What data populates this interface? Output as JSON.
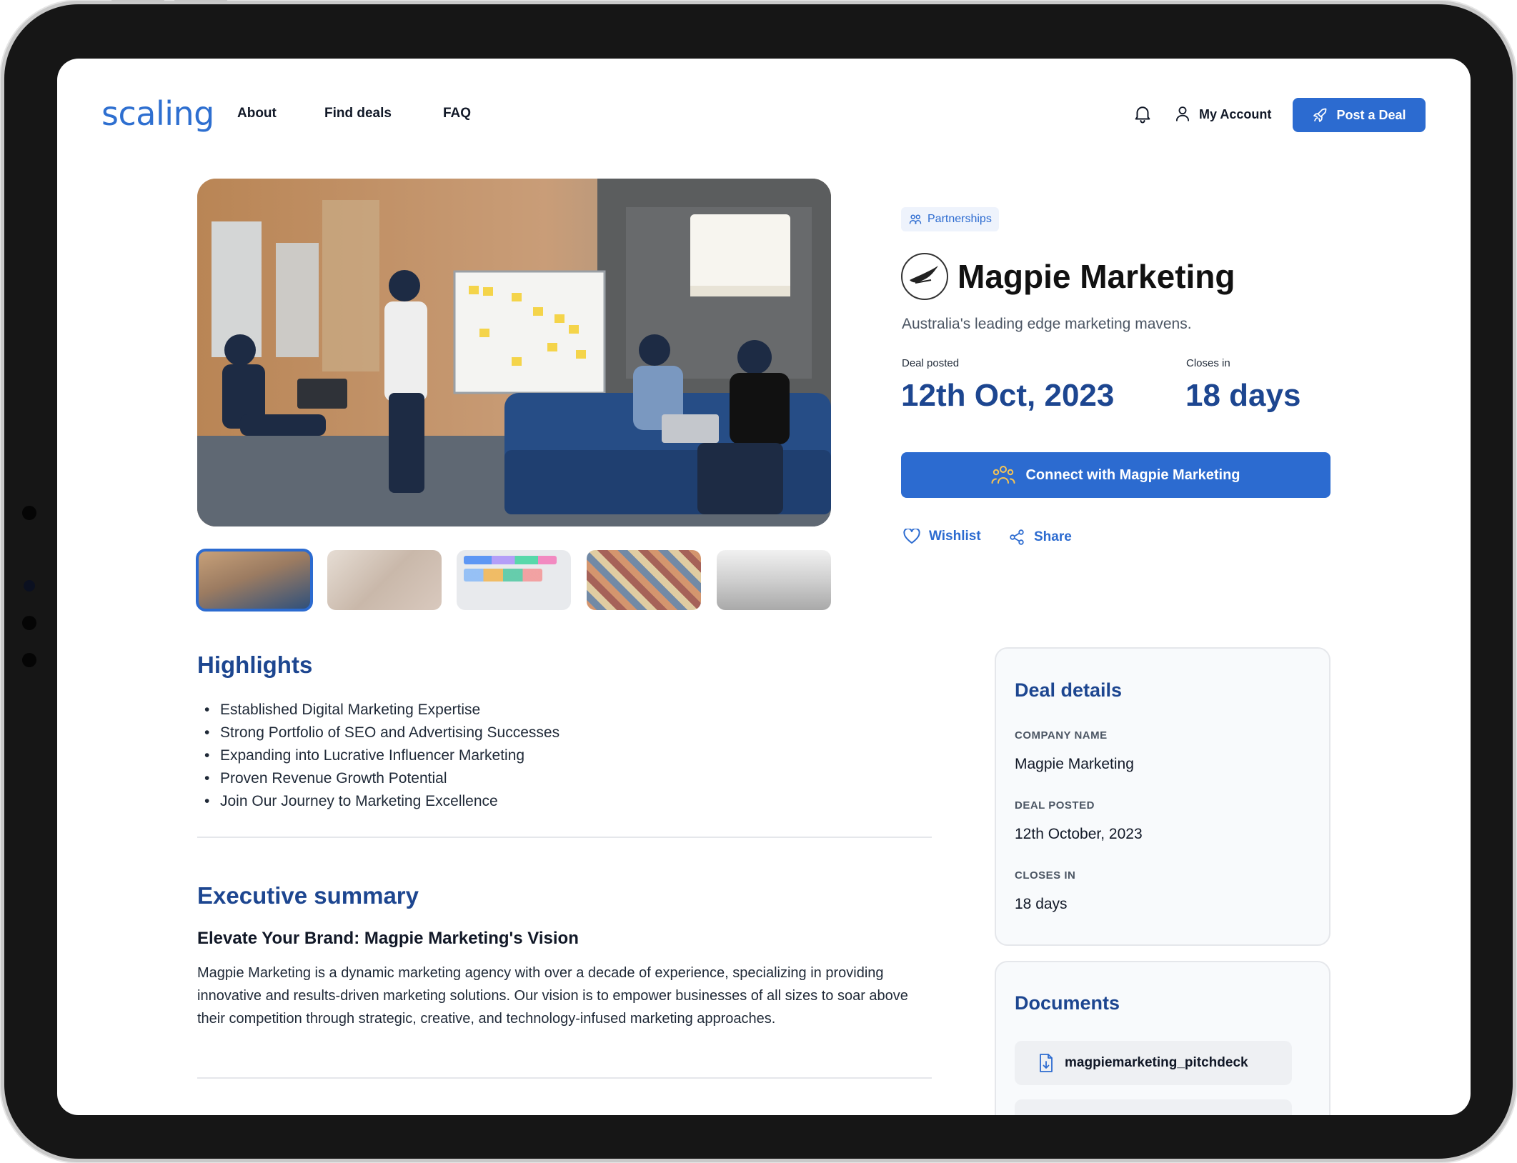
{
  "nav": {
    "logo": "scaling",
    "links": [
      "About",
      "Find deals",
      "FAQ"
    ],
    "account_label": "My Account",
    "post_button": "Post a Deal"
  },
  "deal": {
    "category": "Partnerships",
    "company_name": "Magpie Marketing",
    "tagline": "Australia's leading edge marketing mavens.",
    "posted_label": "Deal posted",
    "posted_value": "12th Oct, 2023",
    "closes_label": "Closes in",
    "closes_value": "18 days",
    "connect_button": "Connect with Magpie Marketing",
    "wishlist": "Wishlist",
    "share": "Share"
  },
  "highlights": {
    "title": "Highlights",
    "items": [
      "Established Digital Marketing Expertise",
      "Strong Portfolio of SEO and Advertising Successes",
      "Expanding into Lucrative Influencer Marketing",
      "Proven Revenue Growth Potential",
      "Join Our Journey to Marketing Excellence"
    ]
  },
  "summary": {
    "title": "Executive summary",
    "subtitle": "Elevate Your Brand: Magpie Marketing's Vision",
    "body": "Magpie Marketing is a dynamic marketing agency with over a decade of experience, specializing in providing innovative and results-driven marketing solutions. Our vision is to empower businesses of all sizes to soar above their competition through strategic, creative, and technology-infused marketing approaches."
  },
  "deal_details": {
    "title": "Deal details",
    "company_label": "COMPANY NAME",
    "company_value": "Magpie Marketing",
    "posted_label": "DEAL POSTED",
    "posted_value": "12th October, 2023",
    "closes_label": "CLOSES IN",
    "closes_value": "18 days"
  },
  "documents": {
    "title": "Documents",
    "items": [
      "magpiemarketing_pitchdeck"
    ]
  },
  "colors": {
    "primary": "#2c6bd0",
    "heading": "#1d4690",
    "tag_bg": "#eef3fc"
  }
}
